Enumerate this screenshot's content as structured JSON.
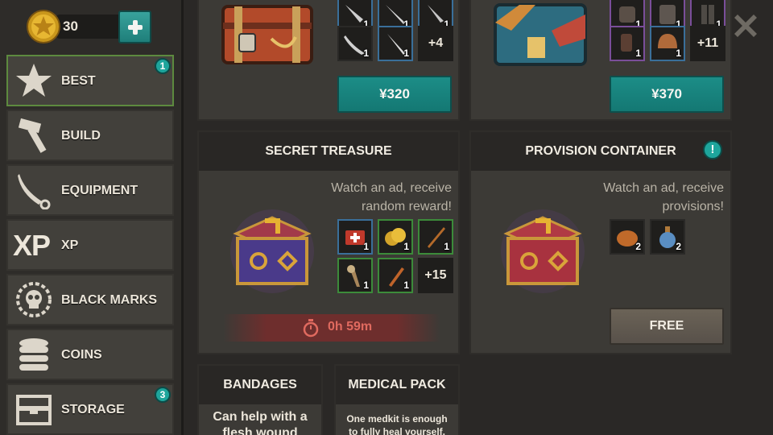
{
  "currency": {
    "coins": "30",
    "icon": "gold-coin-icon",
    "add_icon": "plus-icon"
  },
  "sidebar": {
    "items": [
      {
        "label": "BEST",
        "icon": "star-icon",
        "badge": "1",
        "active": true
      },
      {
        "label": "BUILD",
        "icon": "hammer-icon"
      },
      {
        "label": "EQUIPMENT",
        "icon": "saber-icon"
      },
      {
        "label": "XP",
        "icon": "xp-icon",
        "icon_text": "XP"
      },
      {
        "label": "BLACK MARKS",
        "icon": "skull-gear-icon"
      },
      {
        "label": "COINS",
        "icon": "coin-stack-icon"
      },
      {
        "label": "STORAGE",
        "icon": "chest-icon",
        "badge": "3"
      }
    ]
  },
  "offers": {
    "left_top": {
      "item_counts": [
        "1",
        "1",
        "1",
        "1",
        "1"
      ],
      "more": "+4",
      "price": "¥320"
    },
    "right_top": {
      "item_counts": [
        "1",
        "1",
        "1",
        "1",
        "1"
      ],
      "more": "+11",
      "price": "¥370"
    },
    "secret_treasure": {
      "title": "SECRET TREASURE",
      "description_line1": "Watch an ad, receive",
      "description_line2": "random reward!",
      "item_counts": [
        "1",
        "1",
        "1",
        "1",
        "1"
      ],
      "more": "+15",
      "timer": "0h 59m"
    },
    "provision_container": {
      "title": "PROVISION CONTAINER",
      "info_badge": "!",
      "description_line1": "Watch an ad, receive",
      "description_line2": "provisions!",
      "item_counts": [
        "2",
        "2"
      ],
      "button": "FREE"
    },
    "bandages": {
      "title": "BANDAGES",
      "line1": "Can help with a",
      "line2": "flesh wound"
    },
    "medical_pack": {
      "title": "MEDICAL PACK",
      "line1": "One medkit is enough",
      "line2": "to fully heal yourself."
    }
  },
  "colors": {
    "accent_teal": "#1c8d87",
    "active_border": "#5d8a3f",
    "timer_red": "#e06a5f"
  }
}
